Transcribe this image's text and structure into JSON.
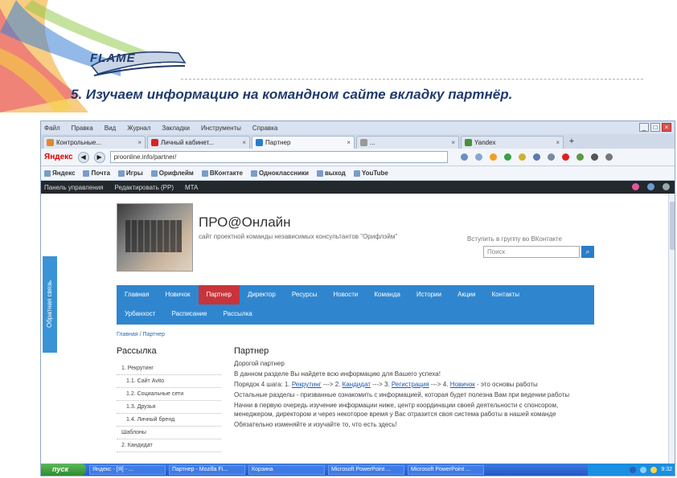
{
  "slide": {
    "logo_text": "FLAME",
    "title": "5. Изучаем информацию на командном сайте вкладку партнёр."
  },
  "browser": {
    "menu": [
      "Файл",
      "Правка",
      "Вид",
      "Журнал",
      "Закладки",
      "Инструменты",
      "Справка"
    ],
    "tabs": [
      {
        "label": "Контрольные...",
        "color": "#e08a2a",
        "active": false
      },
      {
        "label": "Личный кабинет...",
        "color": "#d22",
        "active": false
      },
      {
        "label": "Партнер",
        "color": "#2a7dc8",
        "active": true
      },
      {
        "label": "...",
        "color": "#999",
        "active": false
      },
      {
        "label": "Yandex",
        "color": "#4a8f3a",
        "active": false
      }
    ],
    "search_engine": "Яндекс",
    "url": "proonline.info/partner/",
    "bookmarks": [
      "Яндекс",
      "Почта",
      "Игры",
      "Орифлейм",
      "ВКонтакте",
      "Одноклассники",
      "выход",
      "YouTube"
    ],
    "admin_bar": [
      "Панель управления",
      "Редактировать (PP)",
      "MTA"
    ]
  },
  "site": {
    "feedback": "Обратная связь",
    "title": "ПРО@Онлайн",
    "subtitle": "сайт проектной команды независимых консультантов \"Орифлэйм\"",
    "join": "Вступить в группу во ВКонтакте",
    "search_placeholder": "Поиск",
    "nav_row1": [
      "Главная",
      "Новичок",
      "Партнер",
      "Директор",
      "Ресурсы",
      "Новости",
      "Команда",
      "Истории",
      "Акции",
      "Контакты"
    ],
    "nav_row2": [
      "Урбанхост",
      "Расписание",
      "Рассылка"
    ],
    "breadcrumb": "Главная / Партнер",
    "left": {
      "title": "Рассылка",
      "items": [
        "1. Рекрутинг",
        "1.1. Сайт Avito",
        "1.2. Социальные сети",
        "1.3. Друзья",
        "1.4. Личный бренд",
        "Шаблоны",
        "2. Кандидат"
      ]
    },
    "right": {
      "title": "Партнер",
      "greeting": "Дорогой партнер",
      "p1": "В данном разделе Вы найдете всю информацию для Вашего успеха!",
      "p2_pre": "Порядок 4 шага: 1.",
      "link1": "Рекрутинг",
      "p2_mid1": "---> 2.",
      "link2": "Кандидат",
      "p2_mid2": "---> 3.",
      "link3": "Регистрация",
      "p2_mid3": "---> 4.",
      "link4": "Новичок",
      "p2_post": "- это основы работы",
      "p3": "Остальные разделы - призванные ознакомить с информацией, которая будет полезна Вам при ведении работы",
      "p4": "Начни в первую очередь изучение информации ниже, центр координации своей деятельности с спонсором, менеджером, директором и через некоторое время у Вас отразится своя система работы в нашей команде",
      "p5": "Обязательно изменяйте и изучайте то, что есть здесь!"
    }
  },
  "taskbar": {
    "start": "пуск",
    "tasks": [
      "Яндекс - [Я] - ...",
      "Партнер - Mozilla Fi...",
      "Корзина",
      "Microsoft PowerPoint ...",
      "Microsoft PowerPoint ..."
    ],
    "time": "9:32"
  }
}
